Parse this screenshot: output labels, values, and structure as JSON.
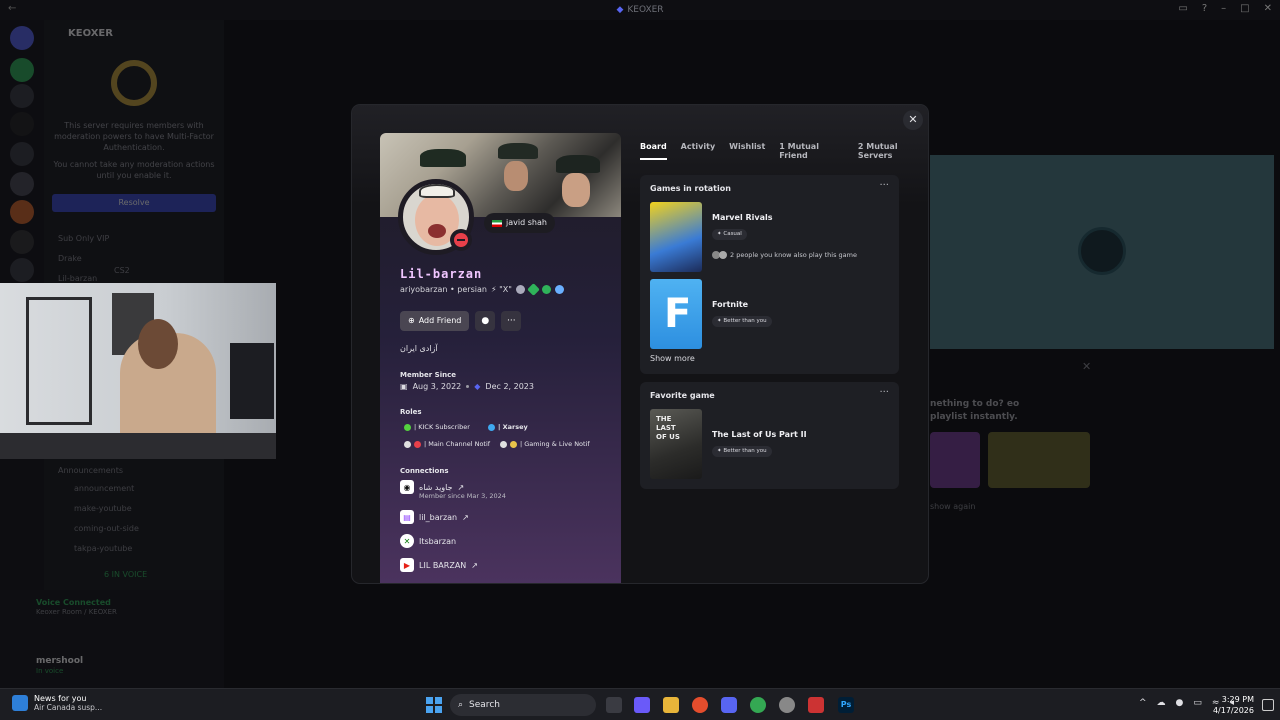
{
  "window": {
    "title": "KEOXER"
  },
  "background_app": {
    "server_name": "KEOXER",
    "mfa_notice": "This server requires members with moderation powers to have Multi-Factor Authentication.",
    "mfa_sub": "You cannot take any moderation actions until you enable it.",
    "resolve_label": "Resolve",
    "channels": [
      "Sub Only VIP",
      "Drake",
      "CS2",
      "Lil-barzan",
      "Announcements",
      "announcement",
      "make-youtube",
      "coming-out-side",
      "takpa-youtube"
    ],
    "voice_state": "6 IN VOICE",
    "voice_connected": "Voice Connected",
    "voice_room": "Keoxer Room / KEOXER",
    "current_user": "mershool",
    "current_user_status": "In voice",
    "activity_prompt": "nething to do? eo playlist instantly.",
    "show_again": "show again"
  },
  "profile": {
    "custom_status": "javid shah",
    "display_name": "Lil-barzan",
    "username_line": "ariyobarzan • persian",
    "username_extra": "⚡ \"X\"",
    "add_friend_label": "Add Friend",
    "bio": "آزادی ایران",
    "member_since_label": "Member Since",
    "member_since_discord": "Aug 3, 2022",
    "member_since_server": "Dec 2, 2023",
    "roles_label": "Roles",
    "roles": [
      {
        "name": "| KICK Subscriber",
        "color": "#54d13f"
      },
      {
        "name": "| Xarsey",
        "color": "#3fa9f0"
      },
      {
        "name": "| Main Channel Notif",
        "color": "#e0e0e0"
      },
      {
        "name": "| Gaming & Live Notif",
        "color": "#e8c44a"
      }
    ],
    "connections_label": "Connections",
    "connections": [
      {
        "name": "جاوید شاه",
        "icon": "steam-icon",
        "sub": "Member since Mar 3, 2024"
      },
      {
        "name": "lil_barzan",
        "icon": "twitch-icon"
      },
      {
        "name": "Itsbarzan",
        "icon": "xbox-icon"
      },
      {
        "name": "LIL BARZAN",
        "icon": "youtube-icon"
      }
    ]
  },
  "tabs": [
    "Board",
    "Activity",
    "Wishlist",
    "1 Mutual Friend",
    "2 Mutual Servers"
  ],
  "board": {
    "games_title": "Games in rotation",
    "games": [
      {
        "name": "Marvel Rivals",
        "tag": "Casual",
        "mutual": "2 people you know also play this game"
      },
      {
        "name": "Fortnite",
        "tag": "Better than you"
      }
    ],
    "show_more_label": "Show more",
    "favorite_title": "Favorite game",
    "favorite": {
      "name": "The Last of Us Part II",
      "tag": "Better than you"
    }
  },
  "taskbar": {
    "news_title": "News for you",
    "news_sub": "Air Canada susp...",
    "search_label": "Search",
    "time": "3:29 PM",
    "date": "4/17/2026",
    "chevron": "^"
  }
}
